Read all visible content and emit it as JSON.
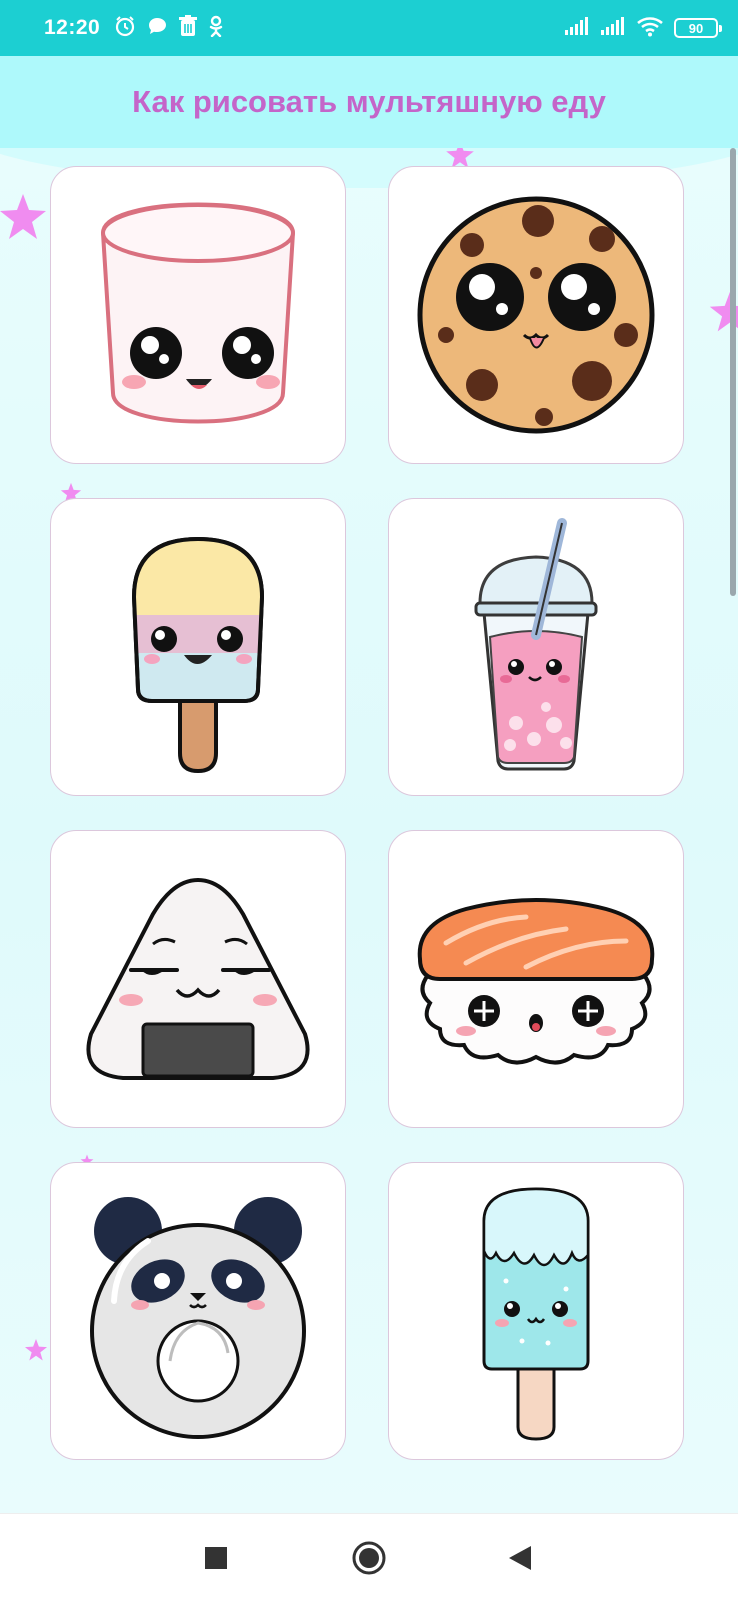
{
  "status_bar": {
    "time": "12:20",
    "battery": "90",
    "notification_icons": [
      "alarm-icon",
      "chat-icon",
      "trash-icon",
      "odnoklassniki-icon"
    ],
    "system_icons": [
      "signal-icon",
      "signal-icon",
      "wifi-icon",
      "battery-icon"
    ]
  },
  "header": {
    "title": "Как рисовать мультяшную еду",
    "background": "#aef9fb",
    "title_color": "#c465c9"
  },
  "grid": {
    "items": [
      {
        "name": "marshmallow"
      },
      {
        "name": "cookie"
      },
      {
        "name": "popsicle"
      },
      {
        "name": "bubble-tea"
      },
      {
        "name": "onigiri"
      },
      {
        "name": "sushi"
      },
      {
        "name": "panda-donut"
      },
      {
        "name": "ice-popsicle"
      }
    ]
  },
  "nav_bar": {
    "buttons": [
      "recents-button",
      "home-button",
      "back-button"
    ]
  },
  "colors": {
    "status_bar": "#1ccfd2",
    "background": "#e3fbfc",
    "star": "#ee82ee"
  }
}
